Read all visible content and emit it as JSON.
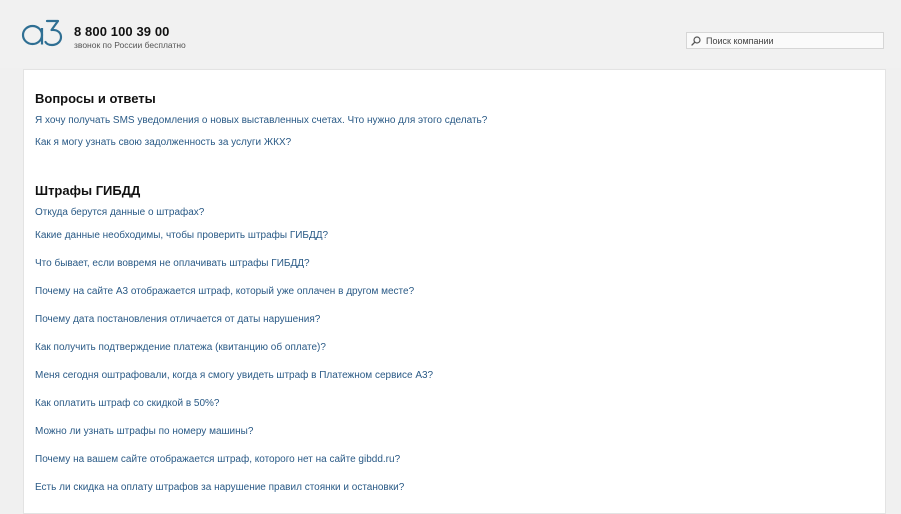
{
  "header": {
    "phone": "8 800 100 39 00",
    "phone_note": "звонок по России бесплатно",
    "search_placeholder": "Поиск компании",
    "search_value": "",
    "logo_icon": "a3-logo-icon",
    "search_icon": "search-icon",
    "accent_color": "#2f6f93"
  },
  "faq": {
    "title": "Вопросы и ответы",
    "questions": [
      "Я хочу получать SMS уведомления о новых выставленных счетах. Что нужно для этого сделать?",
      "Как я могу узнать свою задолженность за услуги ЖКХ?"
    ]
  },
  "fines": {
    "title": "Штрафы ГИБДД",
    "questions": [
      "Откуда берутся данные о штрафах?",
      "Какие данные необходимы, чтобы проверить штрафы ГИБДД?",
      "Что бывает, если вовремя не оплачивать штрафы ГИБДД?",
      "Почему на сайте А3 отображается штраф, который уже оплачен в другом месте?",
      "Почему дата постановления отличается от даты нарушения?",
      "Как получить подтверждение платежа (квитанцию об оплате)?",
      "Меня сегодня оштрафовали, когда я смогу увидеть штраф в Платежном сервисе А3?",
      "Как оплатить штраф со скидкой в 50%?",
      "Можно ли узнать штрафы по номеру машины?",
      "Почему на вашем сайте отображается штраф, которого нет на сайте gibdd.ru?",
      "Есть ли скидка на оплату штрафов за нарушение правил стоянки и остановки?"
    ]
  },
  "colors": {
    "link": "#2a5a86",
    "heading": "#111111",
    "page_bg": "#f0f0f0",
    "panel_bg": "#ffffff"
  }
}
